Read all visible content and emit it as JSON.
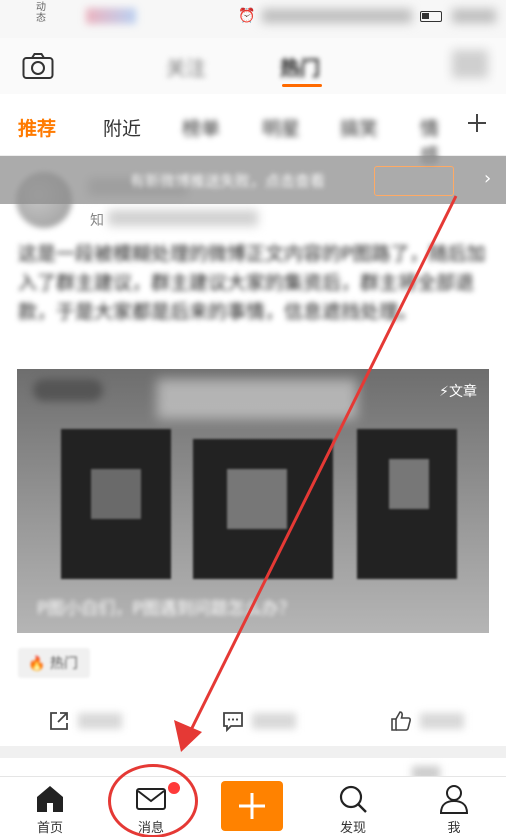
{
  "status_bar": {
    "left_text": "动态",
    "alarm_icon": "alarm-icon",
    "battery_icon": "battery-icon"
  },
  "top_nav": {
    "camera_icon": "camera-icon",
    "tabs": [
      {
        "label": "关注",
        "active": false
      },
      {
        "label": "热门",
        "active": true
      }
    ]
  },
  "channels": {
    "items": [
      {
        "label": "推荐",
        "active": true
      },
      {
        "label": "附近",
        "active": false
      },
      {
        "label": "榜单",
        "active": false
      },
      {
        "label": "明星",
        "active": false
      },
      {
        "label": "搞笑",
        "active": false
      },
      {
        "label": "情感",
        "active": false
      }
    ],
    "add_icon": "plus-icon"
  },
  "banner": {
    "text": "有新微博推送失败，点击查看",
    "chevron_icon": "chevron-right-icon"
  },
  "post": {
    "author_tag": "知",
    "text": "这是一段被模糊处理的微博正文内容的P图路了，随后加入了群主建议，群主建议大家的集资后，群主将全部退款，于是大家都是后来的事情，信息遮挡处理。",
    "image": {
      "tag": "⚡文章",
      "caption": "P图小白们，P图遇到问题怎么办？"
    },
    "hot_tag": "🔥 热门",
    "actions": [
      {
        "name": "share",
        "icon": "share-icon"
      },
      {
        "name": "comment",
        "icon": "comment-icon"
      },
      {
        "name": "like",
        "icon": "like-icon"
      }
    ]
  },
  "bottom_nav": {
    "items": [
      {
        "label": "首页",
        "icon": "home-icon"
      },
      {
        "label": "消息",
        "icon": "message-icon",
        "badge": true
      },
      {
        "label": "",
        "icon": "plus-icon"
      },
      {
        "label": "发现",
        "icon": "discover-icon"
      },
      {
        "label": "我",
        "icon": "profile-icon"
      }
    ]
  },
  "colors": {
    "accent": "#ff7a00",
    "post_button": "#ff8200",
    "annotation": "#e53935",
    "badge": "#ff3a3a"
  }
}
